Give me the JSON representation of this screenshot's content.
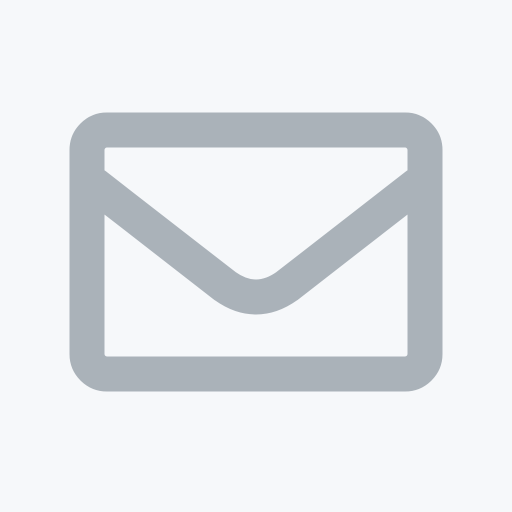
{
  "icon": {
    "name": "mail-icon",
    "stroke_color": "#aab2b9",
    "background_color": "#f6f8fa"
  }
}
